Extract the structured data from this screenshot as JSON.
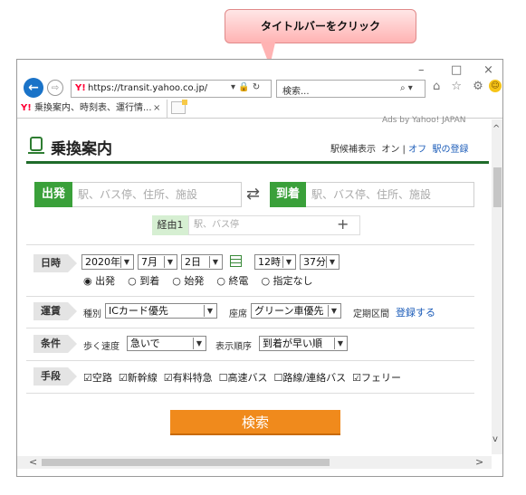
{
  "callout": {
    "text": "タイトルバーをクリック"
  },
  "browser": {
    "url": "https://transit.yahoo.co.jp/",
    "addr_controls": "▾ 🔒 ↻",
    "search_placeholder": "検索...",
    "search_controls": "⌕ ▾",
    "tab_title": "乗換案内、時刻表、運行情...",
    "tab_close": "×",
    "window_controls": {
      "minimize": "–",
      "maximize": "□",
      "close": "×"
    },
    "toolbar_icons": "⌂ ☆ ⚙",
    "back": "←",
    "forward": "⇨"
  },
  "page": {
    "ads": "Ads by Yahoo! JAPAN",
    "title": "乗換案内",
    "station_suggest_label": "駅候補表示",
    "on": "オン",
    "separator": "|",
    "off": "オフ",
    "register_station": "駅の登録",
    "depart_label": "出発",
    "depart_placeholder": "駅、バス停、住所、施設",
    "swap": "⇄",
    "arrive_label": "到着",
    "arrive_placeholder": "駅、バス停、住所、施設",
    "via_label": "経由1",
    "via_placeholder": "駅、バス停",
    "via_add": "+"
  },
  "datetime": {
    "label": "日時",
    "year": "2020年",
    "month": "7月",
    "day": "2日",
    "hour": "12時",
    "minute": "37分",
    "options": [
      "出発",
      "到着",
      "始発",
      "終電",
      "指定なし"
    ],
    "selected": "出発"
  },
  "fare": {
    "label": "運賃",
    "type_label": "種別",
    "type_value": "ICカード優先",
    "seat_label": "座席",
    "seat_value": "グリーン車優先",
    "commuter_label": "定期区間",
    "commuter_link": "登録する"
  },
  "conditions": {
    "label": "条件",
    "speed_label": "歩く速度",
    "speed_value": "急いで",
    "order_label": "表示順序",
    "order_value": "到着が早い順"
  },
  "means": {
    "label": "手段",
    "options": [
      {
        "label": "空路",
        "checked": true
      },
      {
        "label": "新幹線",
        "checked": true
      },
      {
        "label": "有料特急",
        "checked": true
      },
      {
        "label": "高速バス",
        "checked": false
      },
      {
        "label": "路線/連絡バス",
        "checked": false
      },
      {
        "label": "フェリー",
        "checked": true
      }
    ]
  },
  "search_button": "検索",
  "scroll": {
    "up": "^",
    "down": "v",
    "left": "<",
    "right": ">"
  },
  "colors": {
    "accent_green": "#3aa03a",
    "brand_dark_green": "#1f6b2a",
    "search_orange": "#f08a1c",
    "link_blue": "#1a5bb8"
  }
}
